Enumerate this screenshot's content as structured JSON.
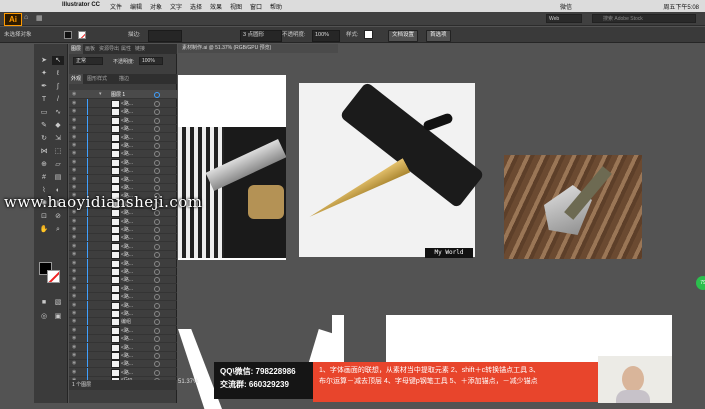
{
  "menubar": {
    "app_name": "Illustrator CC",
    "items": [
      "文件",
      "编辑",
      "对象",
      "文字",
      "选择",
      "效果",
      "视图",
      "窗口",
      "帮助"
    ],
    "tray_text": "微信",
    "clock": "周五下午5:08"
  },
  "control_bar": {
    "no_selection": "未选择对象",
    "stroke_label": "描边:",
    "brush": "3 点圆形",
    "opacity_label": "不透明度:",
    "opacity_value": "100%",
    "style_label": "样式:",
    "doc_setup": "文档设置",
    "preferences": "首选项",
    "workspace": "Web",
    "search_placeholder": "搜索 Adobe Stock"
  },
  "document_tab": "素材制作.ai @ 51.37% (RGB/GPU 预览)",
  "layers_panel": {
    "tabs": [
      "图层",
      "画板",
      "资源导出",
      "属性",
      "链接"
    ],
    "blend_mode": "正常",
    "opacity_label": "不透明度:",
    "opacity_value": "100%",
    "subtabs": [
      "外观",
      "图形样式",
      "描边"
    ],
    "layer_name": "图层 1",
    "items": [
      "<路...",
      "<路...",
      "<路...",
      "<路...",
      "<路...",
      "<路...",
      "<路...",
      "<路...",
      "<路...",
      "<路...",
      "<路...",
      "<路...",
      "<路...",
      "<路...",
      "<路...",
      "<路...",
      "<路...",
      "<路...",
      "<路...",
      "<路...",
      "<路...",
      "<路...",
      "<路...",
      "<路...",
      "<路...",
      "<路...",
      "编组",
      "<路...",
      "<路...",
      "<路...",
      "<路...",
      "<路...",
      "<路...",
      "<Gro..."
    ],
    "footer_count": "1 个图层"
  },
  "canvas": {
    "artwork_label": "My World",
    "watermark": "www.haoyidiansheji.com",
    "qq_line1": "QQ\\微信: 798228986",
    "qq_line2": "交流群: 660329239",
    "tips_line1": "1、字体画面的联想，从素材当中提取元素  2、shift＋c转换锚点工具  3、",
    "tips_line2": "布尔运算－减去顶层  4、字母键p钢笔工具  5、＋添加锚点，－减少锚点",
    "zoom": "51.37%",
    "green_badge": "79"
  }
}
